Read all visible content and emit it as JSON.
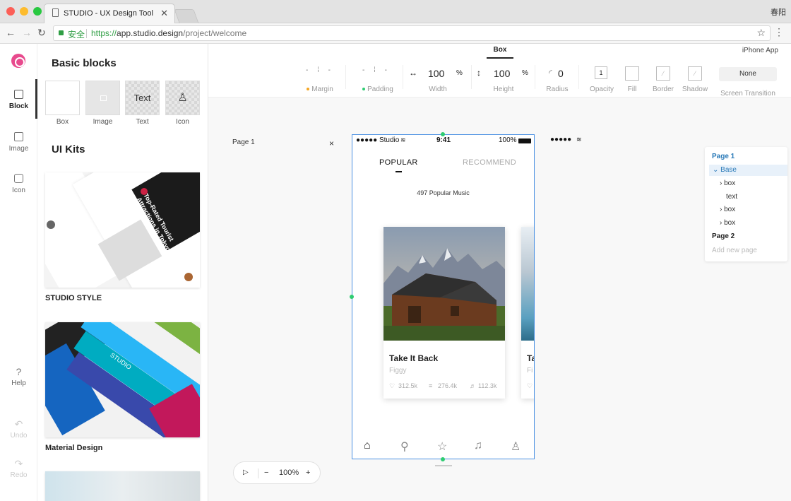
{
  "browser": {
    "tab_title": "STUDIO - UX Design Tool",
    "user": "春阳",
    "secure_label": "安全",
    "url_scheme": "https://",
    "url_host": "app.studio.design",
    "url_path": "/project/welcome"
  },
  "rail": {
    "items": [
      {
        "label": "Block"
      },
      {
        "label": "Image"
      },
      {
        "label": "Icon"
      },
      {
        "label": "Help"
      },
      {
        "label": "Undo"
      },
      {
        "label": "Redo"
      }
    ]
  },
  "panel": {
    "basic_title": "Basic blocks",
    "blocks": [
      {
        "label": "Box"
      },
      {
        "label": "Image"
      },
      {
        "label": "Text",
        "preview": "Text"
      },
      {
        "label": "Icon"
      }
    ],
    "kits_title": "UI Kits",
    "kits": [
      {
        "label": "STUDIO STYLE",
        "preview_text": "Top-Rated Tourist Attractions in Tokyo"
      },
      {
        "label": "Material Design",
        "preview_text": "STUDIO"
      }
    ]
  },
  "toolbar": {
    "active_tab": "Box",
    "device": "iPhone App",
    "margin_label": "Margin",
    "padding_label": "Padding",
    "width_value": "100",
    "width_unit": "%",
    "width_label": "Width",
    "height_value": "100",
    "height_unit": "%",
    "height_label": "Height",
    "radius_value": "0",
    "radius_label": "Radius",
    "opacity_value": "1",
    "opacity_label": "Opacity",
    "fill_label": "Fill",
    "border_label": "Border",
    "shadow_label": "Shadow",
    "transition_value": "None",
    "transition_label": "Screen Transition",
    "margin_color": "#f5a623",
    "padding_color": "#2ecc71"
  },
  "canvas": {
    "page_label": "Page 1",
    "phone": {
      "carrier": "●●●●● Studio",
      "time": "9:41",
      "battery": "100%",
      "tabs": [
        "POPULAR",
        "RECOMMEND"
      ],
      "subtitle": "497 Popular Music",
      "card": {
        "title": "Take It Back",
        "artist": "Figgy",
        "likes": "312.5k",
        "plays": "276.4k",
        "songs": "112.3k"
      },
      "card2": {
        "title": "Ta",
        "artist": "Fi"
      }
    },
    "phone2_status": "●●●●●",
    "zoom": "100%"
  },
  "layers": {
    "items": [
      {
        "label": "Page 1",
        "type": "page-active"
      },
      {
        "label": "Base",
        "type": "selected"
      },
      {
        "label": "box",
        "type": "child"
      },
      {
        "label": "text",
        "type": "child-leaf"
      },
      {
        "label": "box",
        "type": "child"
      },
      {
        "label": "box",
        "type": "child"
      },
      {
        "label": "Page 2",
        "type": "page"
      },
      {
        "label": "Add new page",
        "type": "add"
      }
    ]
  }
}
